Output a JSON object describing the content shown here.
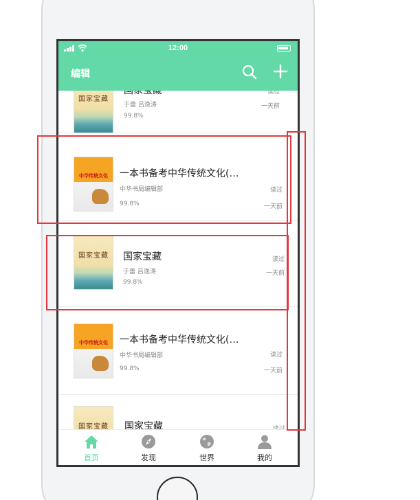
{
  "status_bar": {
    "time": "12:00"
  },
  "nav": {
    "edit_label": "编辑",
    "search_icon": "search-icon",
    "add_icon": "plus-icon"
  },
  "books": [
    {
      "title": "国家宝藏",
      "author": "于蕾 吕逸涛",
      "progress": "99.8%",
      "status": "读过",
      "time": "一天前"
    },
    {
      "title": "一本书备考中华传统文化(…",
      "author": "中华书局编辑部",
      "progress": "99.8%",
      "status": "读过",
      "time": "一天前"
    },
    {
      "title": "国家宝藏",
      "author": "于蕾 吕逸涛",
      "progress": "99.8%",
      "status": "读过",
      "time": "一天前"
    },
    {
      "title": "一本书备考中华传统文化(…",
      "author": "中华书局编辑部",
      "progress": "99.8%",
      "status": "读过",
      "time": "一天前"
    },
    {
      "title": "国家宝藏",
      "status": "读过"
    }
  ],
  "tabs": [
    {
      "label": "首页",
      "icon": "home-icon",
      "active": true
    },
    {
      "label": "发现",
      "icon": "compass-icon",
      "active": false
    },
    {
      "label": "世界",
      "icon": "globe-icon",
      "active": false
    },
    {
      "label": "我的",
      "icon": "user-icon",
      "active": false
    }
  ],
  "colors": {
    "accent": "#62d9a6",
    "annotation": "#e2383d"
  }
}
